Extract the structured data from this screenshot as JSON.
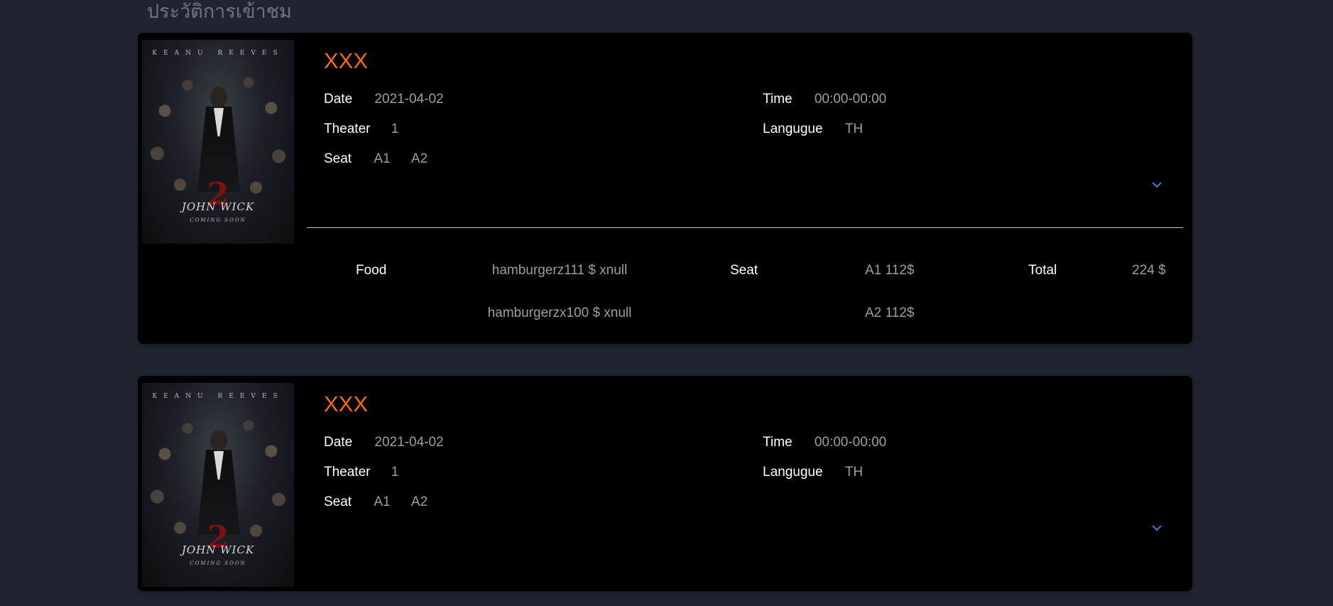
{
  "page": {
    "title": "ประวัติการเข้าชม"
  },
  "labels": {
    "date": "Date",
    "time": "Time",
    "theater": "Theater",
    "language": "Langugue",
    "seat": "Seat",
    "food": "Food",
    "total": "Total"
  },
  "poster": {
    "actor": "KEANU REEVES",
    "number": "2",
    "film": "JOHN WICK",
    "tagline": "COMING SOON"
  },
  "bookings": [
    {
      "movie": "XXX",
      "date": "2021-04-02",
      "time": "00:00-00:00",
      "theater": "1",
      "language": "TH",
      "seats": [
        "A1",
        "A2"
      ],
      "expanded": true,
      "food_items": [
        "hamburgerz111 $ xnull",
        "hamburgerzx100 $ xnull"
      ],
      "seat_prices": [
        "A1 112$",
        "A2 112$"
      ],
      "total": "224 $"
    },
    {
      "movie": "XXX",
      "date": "2021-04-02",
      "time": "00:00-00:00",
      "theater": "1",
      "language": "TH",
      "seats": [
        "A1",
        "A2"
      ],
      "expanded": false
    }
  ],
  "icons": {
    "expand": "chevron-down-icon"
  },
  "colors": {
    "background": "#1f2430",
    "card": "#000000",
    "title_accent": "#f26a1b",
    "chevron": "#3d7be0",
    "muted_text": "#9a9ea6"
  }
}
